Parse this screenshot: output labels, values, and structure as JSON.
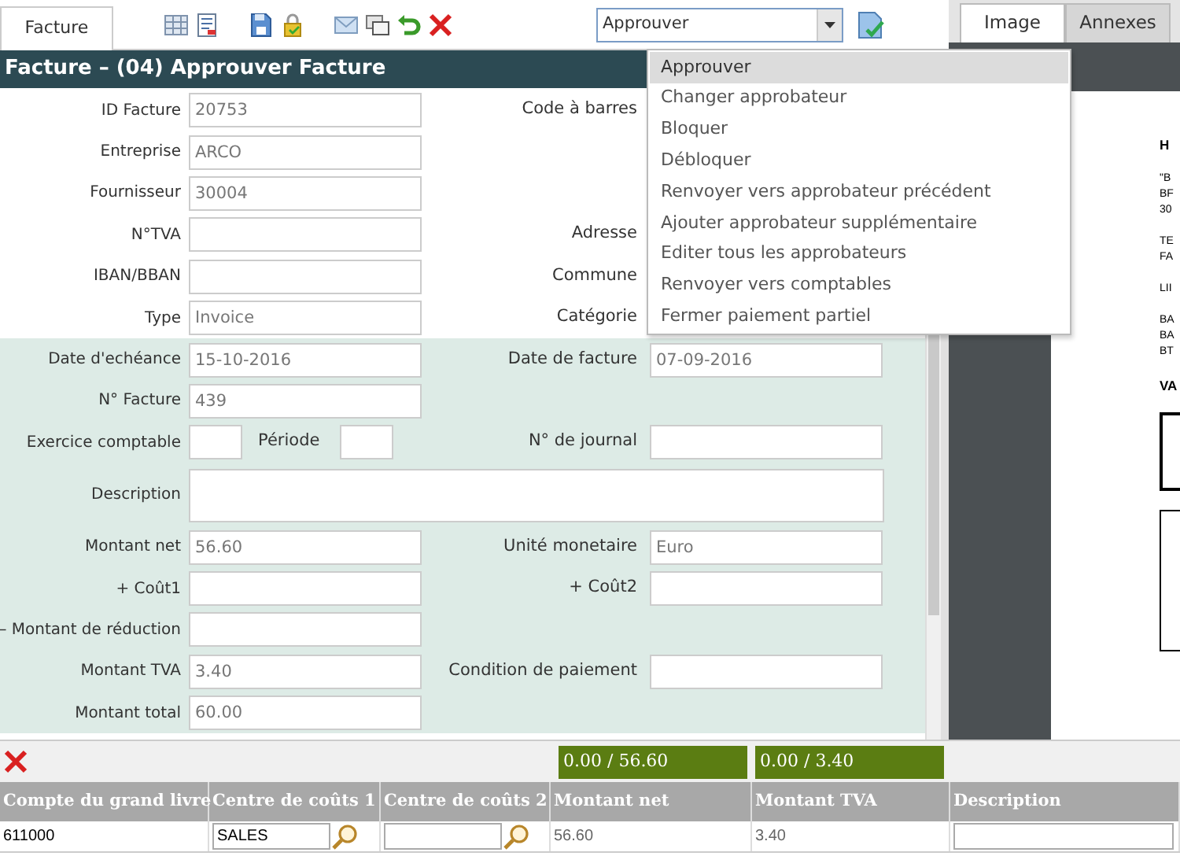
{
  "tabs": [
    {
      "label": "Facture",
      "selected": true
    }
  ],
  "action_select": {
    "value": "Approuver",
    "expanded": true,
    "options": [
      {
        "label": "Approuver",
        "selected": true
      },
      {
        "label": "Changer approbateur",
        "selected": false
      },
      {
        "label": "Bloquer",
        "selected": false
      },
      {
        "label": "Débloquer",
        "selected": false
      },
      {
        "label": "Renvoyer vers approbateur précédent",
        "selected": false
      },
      {
        "label": "Ajouter approbateur supplémentaire",
        "selected": false
      },
      {
        "label": "Editer tous les approbateurs",
        "selected": false
      },
      {
        "label": "Renvoyer vers comptables",
        "selected": false
      },
      {
        "label": "Fermer paiement partiel",
        "selected": false
      }
    ]
  },
  "preview_tabs": [
    {
      "label": "Image",
      "selected": true
    },
    {
      "label": "Annexes",
      "selected": false
    }
  ],
  "form": {
    "title": "Facture – (04) Approuver Facture",
    "sections": [
      {
        "kind": "plain",
        "rows": [
          {
            "left": [
              {
                "kind": "text",
                "label": "ID Facture",
                "value": "20753"
              }
            ],
            "right": [
              {
                "kind": "label",
                "label": "Code à barres"
              }
            ]
          },
          {
            "left": [
              {
                "kind": "text",
                "label": "Entreprise",
                "value": "ARCO"
              }
            ],
            "right": []
          },
          {
            "left": [
              {
                "kind": "text",
                "label": "Fournisseur",
                "value": "30004"
              }
            ],
            "right": []
          },
          {
            "left": [
              {
                "kind": "text",
                "label": "N°TVA"
              }
            ],
            "right": [
              {
                "kind": "label",
                "label": "Adresse"
              }
            ]
          },
          {
            "left": [
              {
                "kind": "text",
                "label": "IBAN/BBAN"
              }
            ],
            "right": [
              {
                "kind": "label",
                "label": "Commune"
              }
            ]
          },
          {
            "left": [
              {
                "kind": "text",
                "label": "Type",
                "value": "Invoice"
              }
            ],
            "right": [
              {
                "kind": "label",
                "label": "Catégorie"
              }
            ]
          }
        ]
      },
      {
        "kind": "tinted",
        "rows": [
          {
            "left": [
              {
                "kind": "text",
                "label": "Date d'echéance",
                "value": "15-10-2016"
              }
            ],
            "right": [
              {
                "kind": "text",
                "label": "Date de facture",
                "value": "07-09-2016"
              }
            ]
          },
          {
            "left": [
              {
                "kind": "text",
                "label": "N° Facture",
                "value": "439"
              }
            ],
            "right": []
          },
          {
            "left": [
              {
                "kind": "short",
                "label": "Exercice comptable"
              },
              {
                "kind": "short",
                "label": "Période"
              }
            ],
            "right": [
              {
                "kind": "text",
                "label": "N° de journal"
              }
            ]
          },
          {
            "left": [
              {
                "kind": "textarea",
                "label": "Description"
              }
            ],
            "right": []
          },
          {
            "left": [
              {
                "kind": "text",
                "label": "Montant net",
                "value": "56.60"
              }
            ],
            "right": [
              {
                "kind": "text",
                "label": "Unité monetaire",
                "value": "Euro"
              }
            ]
          },
          {
            "left": [
              {
                "kind": "text",
                "label": "+ Coût1"
              }
            ],
            "right": [
              {
                "kind": "text",
                "label": "+ Coût2"
              }
            ]
          },
          {
            "left": [
              {
                "kind": "text",
                "label": "– Montant de réduction"
              }
            ],
            "right": []
          },
          {
            "left": [
              {
                "kind": "text",
                "label": "Montant TVA",
                "value": "3.40"
              }
            ],
            "right": [
              {
                "kind": "text",
                "label": "Condition de paiement"
              }
            ]
          },
          {
            "left": [
              {
                "kind": "text",
                "label": "Montant total",
                "value": "60.00"
              }
            ],
            "right": []
          }
        ]
      }
    ]
  },
  "preview": {
    "groups": [
      {
        "kind": "heading",
        "lines": [
          "H"
        ]
      },
      {
        "kind": "text",
        "lines": [
          "\"B",
          "BF",
          "30"
        ]
      },
      {
        "kind": "text",
        "lines": [
          "TE",
          "FA"
        ]
      },
      {
        "kind": "text",
        "lines": [
          "LII"
        ]
      },
      {
        "kind": "text",
        "lines": [
          "BA",
          "BA",
          "BT"
        ]
      },
      {
        "kind": "heading",
        "lines": [
          "VA"
        ]
      }
    ]
  },
  "totals": [
    "0.00 / 56.60",
    "0.00 / 3.40"
  ],
  "grid": {
    "columns": [
      "Compte du grand livre",
      "Centre de coûts 1",
      "Centre de coûts 2",
      "Montant net",
      "Montant TVA",
      "Description"
    ],
    "rows": [
      {
        "cells": [
          {
            "kind": "text",
            "value": "611000"
          },
          {
            "kind": "lookup",
            "value": "SALES"
          },
          {
            "kind": "lookup"
          },
          {
            "kind": "text",
            "value": "56.60"
          },
          {
            "kind": "text",
            "value": "3.40"
          },
          {
            "kind": "input"
          }
        ]
      }
    ]
  }
}
